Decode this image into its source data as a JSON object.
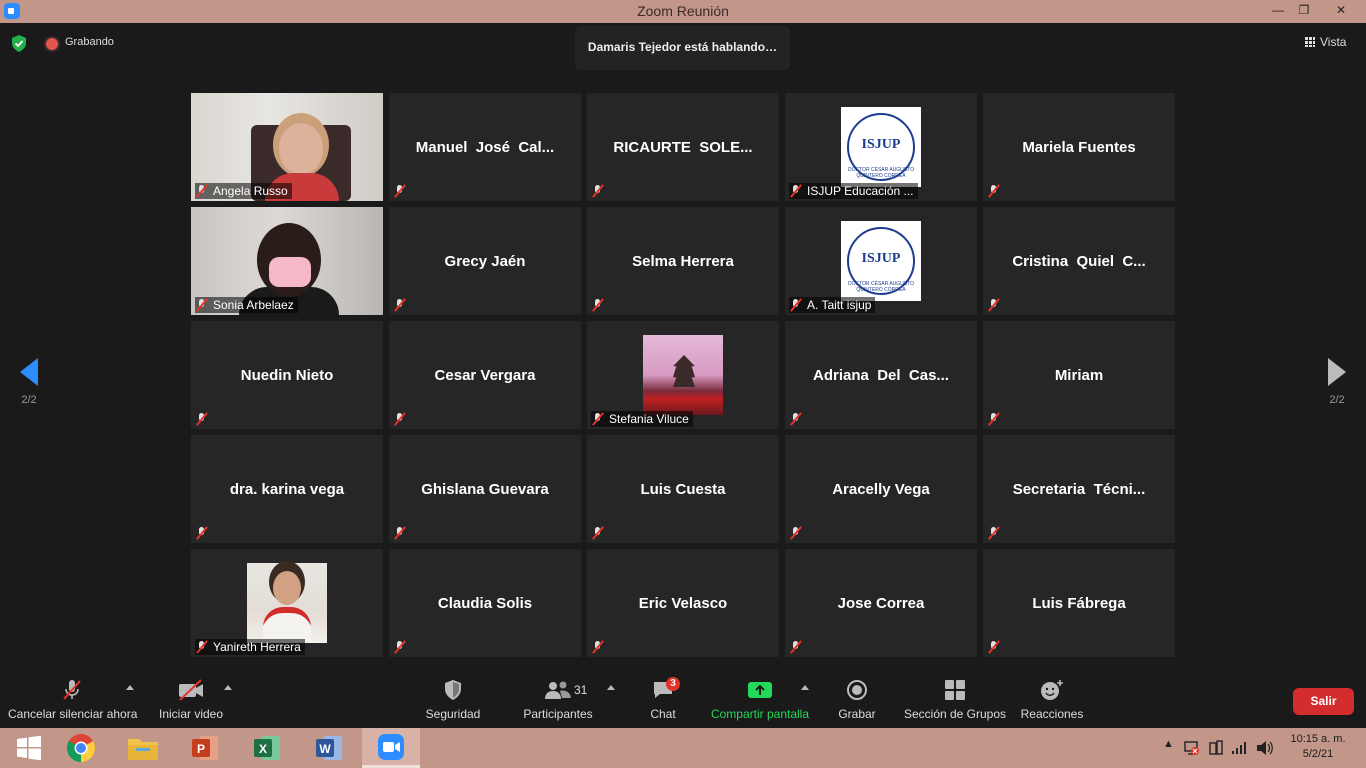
{
  "window": {
    "title": "Zoom Reunión",
    "minimize": "—",
    "maximize": "❐",
    "close": "✕"
  },
  "header": {
    "recording": "Grabando",
    "speaking": "Damaris Tejedor está hablando…",
    "view": "Vista"
  },
  "pager": {
    "left_page": "2/2",
    "right_page": "2/2"
  },
  "participants": [
    {
      "name": "",
      "caption": "Angela Russo",
      "type": "video1"
    },
    {
      "name": "Manuel  José  Cal...",
      "caption": "",
      "type": "name"
    },
    {
      "name": "RICAURTE  SOLE...",
      "caption": "",
      "type": "name"
    },
    {
      "name": "",
      "caption": "ISJUP Educación ...",
      "type": "logo"
    },
    {
      "name": "Mariela Fuentes",
      "caption": "",
      "type": "name"
    },
    {
      "name": "",
      "caption": "Sonia Arbelaez",
      "type": "video2"
    },
    {
      "name": "Grecy Jaén",
      "caption": "",
      "type": "name"
    },
    {
      "name": "Selma Herrera",
      "caption": "",
      "type": "name"
    },
    {
      "name": "",
      "caption": "A. Taitt isjup",
      "type": "logo"
    },
    {
      "name": "Cristina  Quiel  C...",
      "caption": "",
      "type": "name"
    },
    {
      "name": "Nuedin Nieto",
      "caption": "",
      "type": "name"
    },
    {
      "name": "Cesar Vergara",
      "caption": "",
      "type": "name"
    },
    {
      "name": "",
      "caption": "Stefania Viluce",
      "type": "castle"
    },
    {
      "name": "Adriana  Del  Cas...",
      "caption": "",
      "type": "name"
    },
    {
      "name": "Miriam",
      "caption": "",
      "type": "name"
    },
    {
      "name": "dra. karina vega",
      "caption": "",
      "type": "name"
    },
    {
      "name": "Ghislana Guevara",
      "caption": "",
      "type": "name"
    },
    {
      "name": "Luis Cuesta",
      "caption": "",
      "type": "name"
    },
    {
      "name": "Aracelly Vega",
      "caption": "",
      "type": "name"
    },
    {
      "name": "Secretaria  Técni...",
      "caption": "",
      "type": "name"
    },
    {
      "name": "",
      "caption": "Yanireth Herrera",
      "type": "portrait"
    },
    {
      "name": "Claudia Solis",
      "caption": "",
      "type": "name"
    },
    {
      "name": "Eric Velasco",
      "caption": "",
      "type": "name"
    },
    {
      "name": "Jose Correa",
      "caption": "",
      "type": "name"
    },
    {
      "name": "Luis Fábrega",
      "caption": "",
      "type": "name"
    }
  ],
  "logo": {
    "brand": "ISJUP",
    "sub": "DOCTOR CÉSAR AUGUSTO QUINTERO CORREA"
  },
  "controls": {
    "unmute": "Cancelar silenciar ahora",
    "start_video": "Iniciar video",
    "security": "Seguridad",
    "participants": "Participantes",
    "participants_count": "31",
    "chat": "Chat",
    "chat_badge": "3",
    "share": "Compartir pantalla",
    "record": "Grabar",
    "breakout": "Sección de Grupos",
    "reactions": "Reacciones",
    "leave": "Salir"
  },
  "taskbar": {
    "time": "10:15 a. m.",
    "date": "5/2/21"
  },
  "colors": {
    "accent": "#2d8cff",
    "share_green": "#23d959",
    "leave_red": "#d32d2d",
    "titlebar": "#c2978a"
  }
}
